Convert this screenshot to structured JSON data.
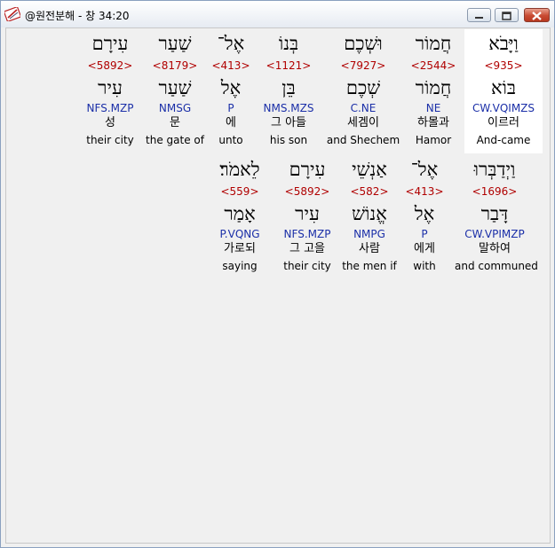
{
  "window": {
    "title": "@원전분해 - 창 34:20"
  },
  "row1": [
    {
      "heb": "וַיָּבֹא",
      "strong": "<935>",
      "root": "בּוֹא",
      "morph": "CW.VQIMZS",
      "kor": "이르러",
      "eng": "And-came"
    },
    {
      "heb": "חֲמוֹר",
      "strong": "<2544>",
      "root": "חֲמוֹר",
      "morph": "NE",
      "kor": "하몰과",
      "eng": "Hamor"
    },
    {
      "heb": "וּשְׁכֶם",
      "strong": "<7927>",
      "root": "שְׁכֶם",
      "morph": "C.NE",
      "kor": "세겜이",
      "eng": "and Shechem"
    },
    {
      "heb": "בְּנוֹ",
      "strong": "<1121>",
      "root": "בֵּן",
      "morph": "NMS.MZS",
      "kor": "그 아들",
      "eng": "his son"
    },
    {
      "heb": "אֶל־",
      "strong": "<413>",
      "root": "אֶל",
      "morph": "P",
      "kor": "에",
      "eng": "unto"
    },
    {
      "heb": "שַׁעַר",
      "strong": "<8179>",
      "root": "שַׁעַר",
      "morph": "NMSG",
      "kor": "문",
      "eng": "the gate of"
    },
    {
      "heb": "עִירָם",
      "strong": "<5892>",
      "root": "עִיר",
      "morph": "NFS.MZP",
      "kor": "성",
      "eng": "their city"
    }
  ],
  "row2": [
    {
      "heb": "וַיְדַבְּרוּ",
      "strong": "<1696>",
      "root": "דָּבַר",
      "morph": "CW.VPIMZP",
      "kor": "말하여",
      "eng": "and communed"
    },
    {
      "heb": "אֶל־",
      "strong": "<413>",
      "root": "אֶל",
      "morph": "P",
      "kor": "에게",
      "eng": "with"
    },
    {
      "heb": "אַנְשֵׁי",
      "strong": "<582>",
      "root": "אֱנוֹשׁ",
      "morph": "NMPG",
      "kor": "사람",
      "eng": "the men if"
    },
    {
      "heb": "עִירָם",
      "strong": "<5892>",
      "root": "עִיר",
      "morph": "NFS.MZP",
      "kor": "그 고을",
      "eng": "their city"
    },
    {
      "heb": "לֵאמֹר׃",
      "strong": "<559>",
      "root": "אָמַר",
      "morph": "P.VQNG",
      "kor": "가로되",
      "eng": "saying"
    }
  ]
}
